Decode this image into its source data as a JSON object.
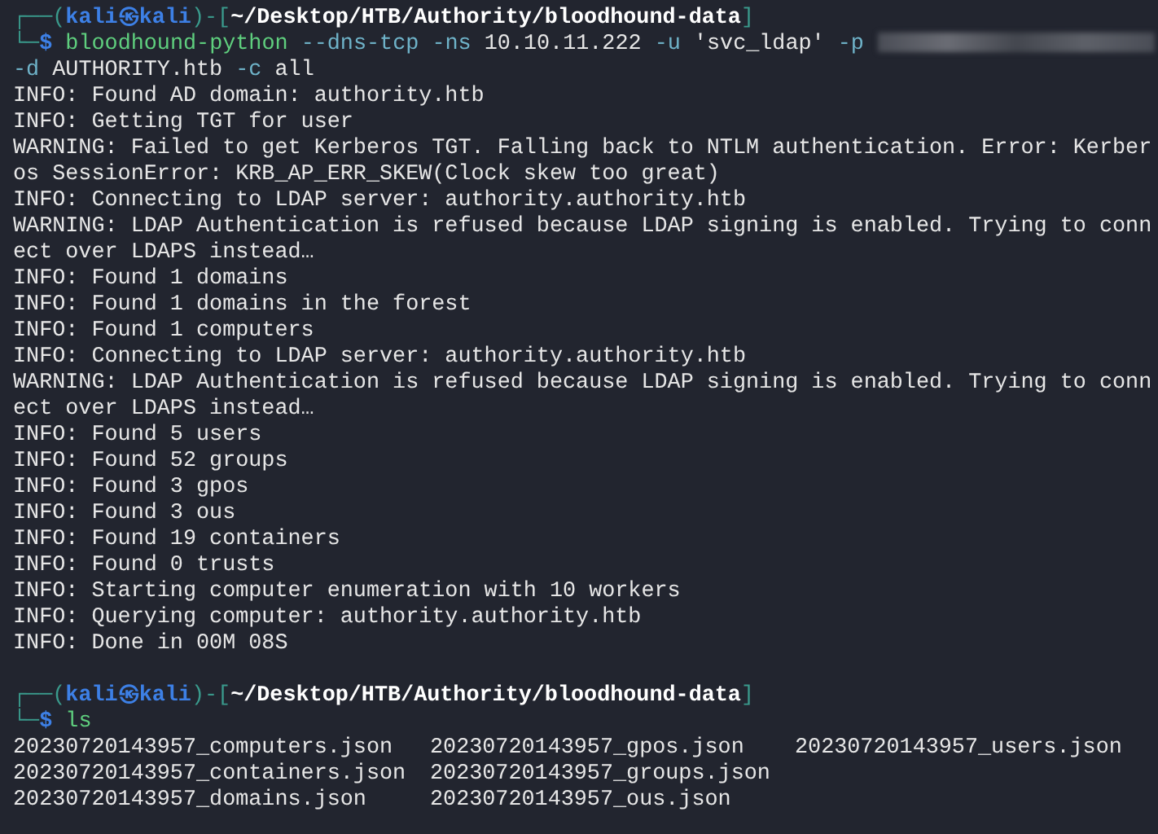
{
  "blocks": [
    {
      "prompt": {
        "open": "┌──(",
        "user": "kali",
        "at": "㉿",
        "host": "kali",
        "mid": ")-[",
        "path": "~/Desktop/HTB/Authority/bloodhound-data",
        "close": "]",
        "corner": "└─",
        "symbol": "$"
      },
      "command_lines": [
        [
          {
            "kind": "program",
            "text": "bloodhound-python"
          },
          {
            "kind": "option",
            "text": "--dns-tcp"
          },
          {
            "kind": "option",
            "text": "-ns"
          },
          {
            "kind": "arg",
            "text": "10.10.11.222"
          },
          {
            "kind": "option",
            "text": "-u"
          },
          {
            "kind": "arg",
            "text": "'svc_ldap'"
          },
          {
            "kind": "option",
            "text": "-p"
          },
          {
            "kind": "redacted"
          }
        ],
        [
          {
            "kind": "option",
            "text": "-d"
          },
          {
            "kind": "arg",
            "text": "AUTHORITY.htb"
          },
          {
            "kind": "option",
            "text": "-c"
          },
          {
            "kind": "arg",
            "text": "all"
          }
        ]
      ],
      "output": [
        "INFO: Found AD domain: authority.htb",
        "INFO: Getting TGT for user",
        "WARNING: Failed to get Kerberos TGT. Falling back to NTLM authentication. Error: Kerber",
        "os SessionError: KRB_AP_ERR_SKEW(Clock skew too great)",
        "INFO: Connecting to LDAP server: authority.authority.htb",
        "WARNING: LDAP Authentication is refused because LDAP signing is enabled. Trying to conn",
        "ect over LDAPS instead…",
        "INFO: Found 1 domains",
        "INFO: Found 1 domains in the forest",
        "INFO: Found 1 computers",
        "INFO: Connecting to LDAP server: authority.authority.htb",
        "WARNING: LDAP Authentication is refused because LDAP signing is enabled. Trying to conn",
        "ect over LDAPS instead…",
        "INFO: Found 5 users",
        "INFO: Found 52 groups",
        "INFO: Found 3 gpos",
        "INFO: Found 3 ous",
        "INFO: Found 19 containers",
        "INFO: Found 0 trusts",
        "INFO: Starting computer enumeration with 10 workers",
        "INFO: Querying computer: authority.authority.htb",
        "INFO: Done in 00M 08S"
      ]
    },
    {
      "prompt": {
        "open": "┌──(",
        "user": "kali",
        "at": "㉿",
        "host": "kali",
        "mid": ")-[",
        "path": "~/Desktop/HTB/Authority/bloodhound-data",
        "close": "]",
        "corner": "└─",
        "symbol": "$"
      },
      "command_lines": [
        [
          {
            "kind": "program",
            "text": "ls"
          }
        ]
      ],
      "file_rows": [
        [
          "20230720143957_computers.json",
          "20230720143957_gpos.json",
          "20230720143957_users.json"
        ],
        [
          "20230720143957_containers.json",
          "20230720143957_groups.json"
        ],
        [
          "20230720143957_domains.json",
          "20230720143957_ous.json"
        ]
      ]
    }
  ]
}
